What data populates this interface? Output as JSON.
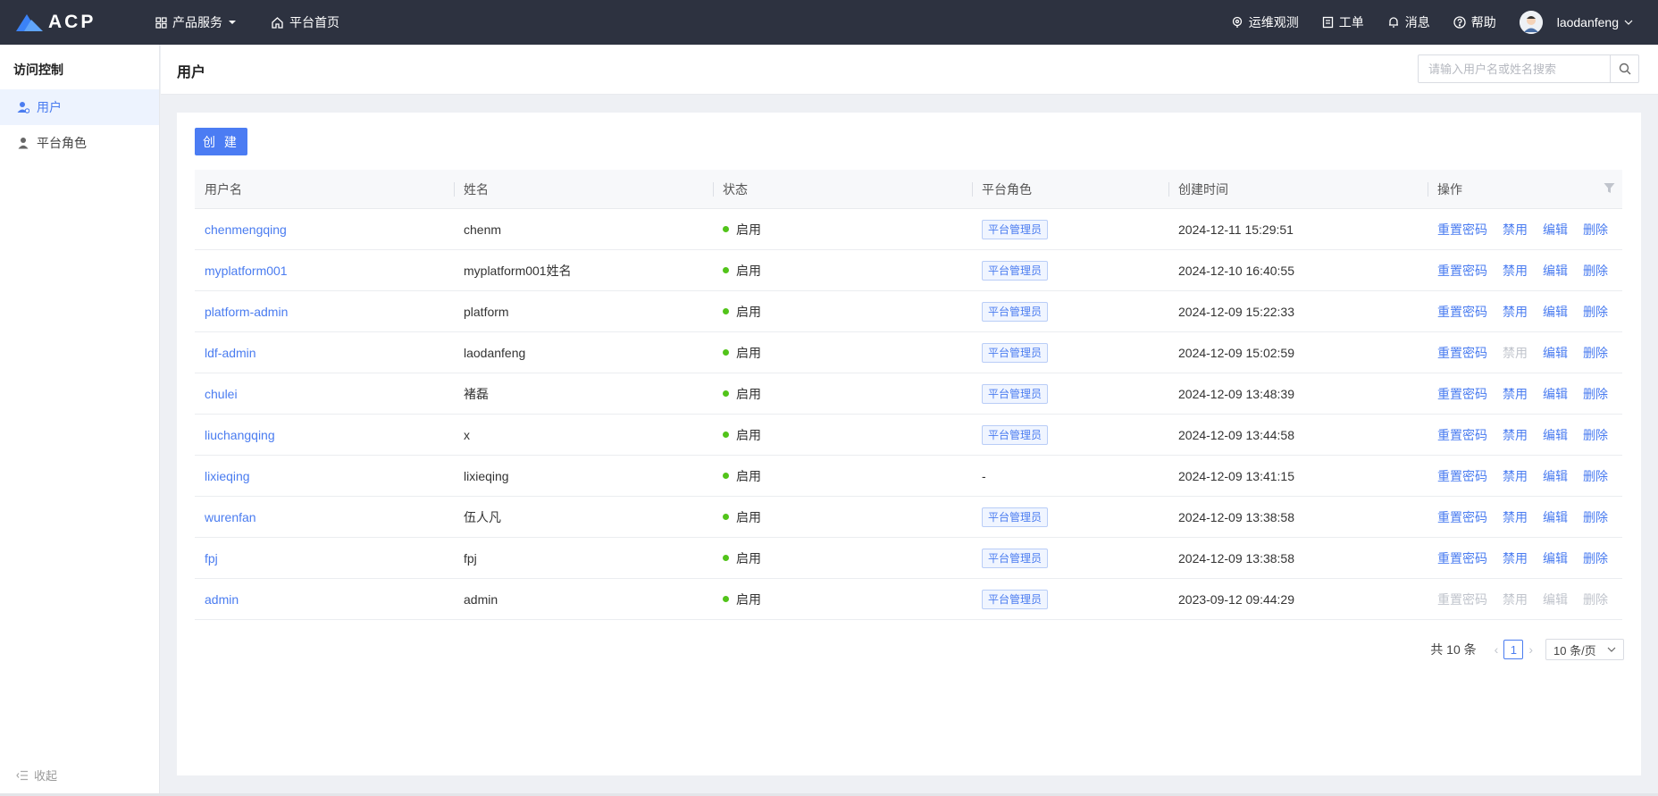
{
  "brand": {
    "name": "ACP"
  },
  "topnav": {
    "products_label": "产品服务",
    "home_label": "平台首页",
    "ops_label": "运维观测",
    "ticket_label": "工单",
    "message_label": "消息",
    "help_label": "帮助",
    "username": "laodanfeng"
  },
  "sidebar": {
    "title": "访问控制",
    "items": [
      {
        "label": "用户",
        "active": true
      },
      {
        "label": "平台角色",
        "active": false
      }
    ],
    "collapse_label": "收起"
  },
  "header": {
    "title": "用户",
    "search_placeholder": "请输入用户名或姓名搜索"
  },
  "toolbar": {
    "create_label": "创 建"
  },
  "table": {
    "columns": [
      "用户名",
      "姓名",
      "状态",
      "平台角色",
      "创建时间",
      "操作"
    ],
    "rows": [
      {
        "username": "chenmengqing",
        "name": "chenm",
        "status": "启用",
        "role": "平台管理员",
        "created": "2024-12-11 15:29:51",
        "ops_disabled": []
      },
      {
        "username": "myplatform001",
        "name": "myplatform001姓名",
        "status": "启用",
        "role": "平台管理员",
        "created": "2024-12-10 16:40:55",
        "ops_disabled": []
      },
      {
        "username": "platform-admin",
        "name": "platform",
        "status": "启用",
        "role": "平台管理员",
        "created": "2024-12-09 15:22:33",
        "ops_disabled": []
      },
      {
        "username": "ldf-admin",
        "name": "laodanfeng",
        "status": "启用",
        "role": "平台管理员",
        "created": "2024-12-09 15:02:59",
        "ops_disabled": [
          1
        ]
      },
      {
        "username": "chulei",
        "name": "褚磊",
        "status": "启用",
        "role": "平台管理员",
        "created": "2024-12-09 13:48:39",
        "ops_disabled": []
      },
      {
        "username": "liuchangqing",
        "name": "x",
        "status": "启用",
        "role": "平台管理员",
        "created": "2024-12-09 13:44:58",
        "ops_disabled": []
      },
      {
        "username": "lixieqing",
        "name": "lixieqing",
        "status": "启用",
        "role": "-",
        "created": "2024-12-09 13:41:15",
        "ops_disabled": []
      },
      {
        "username": "wurenfan",
        "name": "伍人凡",
        "status": "启用",
        "role": "平台管理员",
        "created": "2024-12-09 13:38:58",
        "ops_disabled": []
      },
      {
        "username": "fpj",
        "name": "fpj",
        "status": "启用",
        "role": "平台管理员",
        "created": "2024-12-09 13:38:58",
        "ops_disabled": []
      },
      {
        "username": "admin",
        "name": "admin",
        "status": "启用",
        "role": "平台管理员",
        "created": "2023-09-12 09:44:29",
        "ops_disabled": [
          0,
          1,
          2,
          3
        ]
      }
    ],
    "ops": [
      "重置密码",
      "禁用",
      "编辑",
      "删除"
    ]
  },
  "pagination": {
    "total_label": "共 10 条",
    "current_page": "1",
    "page_size_label": "10 条/页"
  },
  "colors": {
    "accent": "#4a7cf0",
    "topbar": "#2d3240",
    "status_ok": "#52c41a"
  }
}
